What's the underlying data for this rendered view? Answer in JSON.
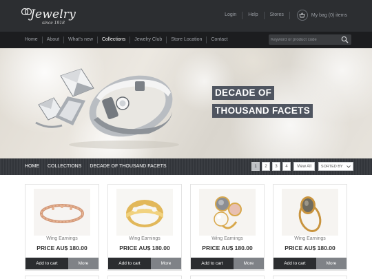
{
  "brand": {
    "logo_text": "Jewelry",
    "logo_subtext": "since 1918"
  },
  "top_links": {
    "login": "Login",
    "help": "Help",
    "stores": "Stores",
    "bag": "My bag (0) items"
  },
  "nav": {
    "items": [
      "Home",
      "About",
      "What's new",
      "Collections",
      "Jewelry Club",
      "Store Location",
      "Contact"
    ],
    "active": "Collections"
  },
  "search": {
    "placeholder": "Keyword or product code",
    "icon": "search-icon"
  },
  "hero": {
    "title_line1": "DECADE OF",
    "title_line2": "THOUSAND FACETS"
  },
  "breadcrumb": {
    "items": [
      "HOME",
      "COLLECTIONS",
      "DECADE OF THOUSAND FACETS"
    ]
  },
  "pagination": {
    "pages": [
      "1",
      "2",
      "3",
      "4"
    ],
    "current": "1",
    "view_all": "View All",
    "sort_label": "SORTED BY"
  },
  "products": [
    {
      "name": "Wing Earnings",
      "price": "PRICE AU$ 180.00",
      "cart_label": "Add to cart",
      "more_label": "More"
    },
    {
      "name": "Wing Earnings",
      "price": "PRICE AU$ 180.00",
      "cart_label": "Add to cart",
      "more_label": "More"
    },
    {
      "name": "Wing Earnings",
      "price": "PRICE AU$ 180.00",
      "cart_label": "Add to cart",
      "more_label": "More"
    },
    {
      "name": "Wing Earnings",
      "price": "PRICE AU$ 180.00",
      "cart_label": "Add to cart",
      "more_label": "More"
    }
  ],
  "colors": {
    "topbar": "#2c2e31",
    "navbar": "#1c1d1f",
    "hero_label_bg": "#4f5560",
    "cart_button": "#2b2d30",
    "more_button": "#7f8287"
  }
}
